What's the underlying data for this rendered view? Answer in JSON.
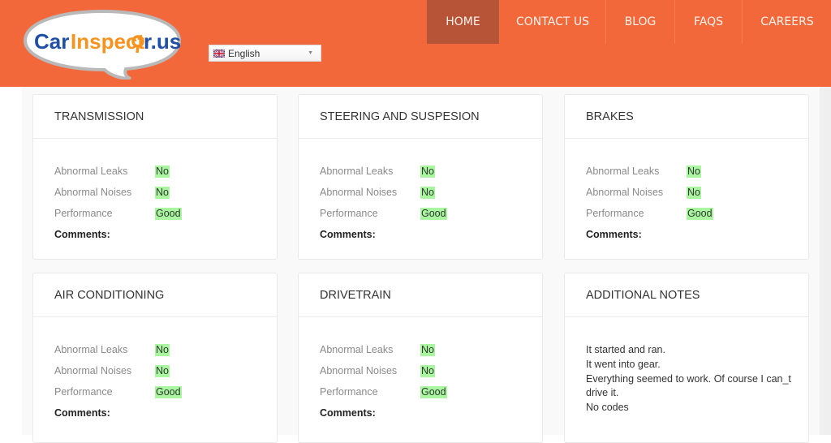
{
  "header": {
    "logo": {
      "text_part1": "Car",
      "text_part2": "Inspect",
      "text_part3": "r.us",
      "brand_color_blue": "#1f4fa6",
      "brand_color_orange": "#f7931e"
    },
    "language_select": {
      "value": "English",
      "flag": "uk-flag-icon"
    },
    "nav": [
      {
        "label": "HOME",
        "active": true
      },
      {
        "label": "CONTACT US",
        "active": false
      },
      {
        "label": "BLOG",
        "active": false
      },
      {
        "label": "FAQS",
        "active": false
      },
      {
        "label": "CAREERS",
        "active": false
      }
    ],
    "accent_color": "#f3683a"
  },
  "sections": [
    {
      "title": "TRANSMISSION",
      "rows": [
        {
          "label": "Abnormal Leaks",
          "value": "No"
        },
        {
          "label": "Abnormal Noises",
          "value": "No"
        },
        {
          "label": "Performance",
          "value": "Good"
        }
      ],
      "comments_label": "Comments:"
    },
    {
      "title": "STEERING AND SUSPESION",
      "rows": [
        {
          "label": "Abnormal Leaks",
          "value": "No"
        },
        {
          "label": "Abnormal Noises",
          "value": "No"
        },
        {
          "label": "Performance",
          "value": "Good"
        }
      ],
      "comments_label": "Comments:"
    },
    {
      "title": "BRAKES",
      "rows": [
        {
          "label": "Abnormal Leaks",
          "value": "No"
        },
        {
          "label": "Abnormal Noises",
          "value": "No"
        },
        {
          "label": "Performance",
          "value": "Good"
        }
      ],
      "comments_label": "Comments:"
    },
    {
      "title": "AIR CONDITIONING",
      "rows": [
        {
          "label": "Abnormal Leaks",
          "value": "No"
        },
        {
          "label": "Abnormal Noises",
          "value": "No"
        },
        {
          "label": "Performance",
          "value": "Good"
        }
      ],
      "comments_label": "Comments:"
    },
    {
      "title": "DRIVETRAIN",
      "rows": [
        {
          "label": "Abnormal Leaks",
          "value": "No"
        },
        {
          "label": "Abnormal Noises",
          "value": "No"
        },
        {
          "label": "Performance",
          "value": "Good"
        }
      ],
      "comments_label": "Comments:"
    }
  ],
  "additional_notes": {
    "title": "ADDITIONAL NOTES",
    "lines": [
      "It started and ran.",
      "It went into gear.",
      "Everything seemed to work. Of course I can_t",
      "drive it.",
      "No codes"
    ]
  },
  "value_highlight_color": "#a9f5a0"
}
